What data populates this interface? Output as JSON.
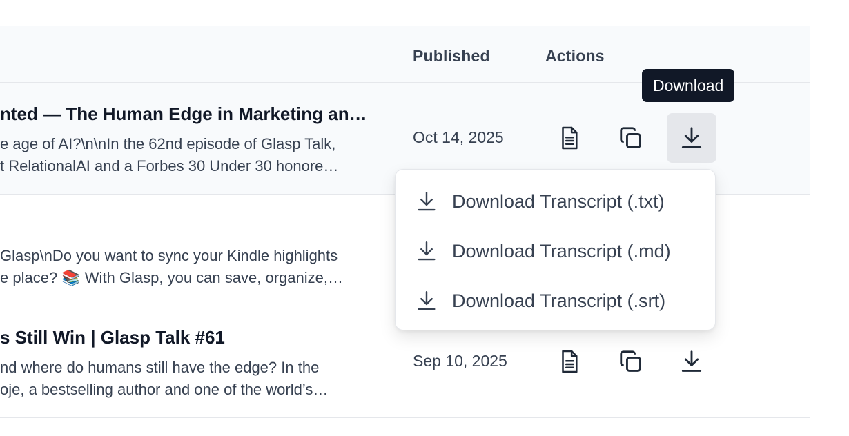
{
  "table": {
    "headers": {
      "published": "Published",
      "actions": "Actions"
    },
    "rows": [
      {
        "title": "nted — The Human Edge in Marketing an…",
        "desc1": "e age of AI?\\n\\nIn the 62nd episode of Glasp Talk,",
        "desc2": "t RelationalAI and a Forbes 30 Under 30 honore…",
        "date": "Oct 14, 2025"
      },
      {
        "title": "",
        "desc1": "Glasp\\nDo you want to sync your Kindle highlights",
        "desc2": "e place? 📚 With Glasp, you can save, organize,…",
        "date": ""
      },
      {
        "title": "s Still Win | Glasp Talk #61",
        "desc1": "nd where do humans still have the edge? In the",
        "desc2": "oje, a bestselling author and one of the world’s…",
        "date": "Sep 10, 2025"
      }
    ]
  },
  "icons": {
    "transcript": "document-icon",
    "copy": "copy-icon",
    "download": "download-icon"
  },
  "tooltip": {
    "text": "Download"
  },
  "download_menu": {
    "items": [
      {
        "label": "Download Transcript (.txt)"
      },
      {
        "label": "Download Transcript (.md)"
      },
      {
        "label": "Download Transcript (.srt)"
      }
    ]
  },
  "colors": {
    "text_primary": "#111827",
    "text_secondary": "#374151",
    "header_bg": "#f8fafc",
    "tooltip_bg": "#111827",
    "border": "#e5e7eb"
  }
}
